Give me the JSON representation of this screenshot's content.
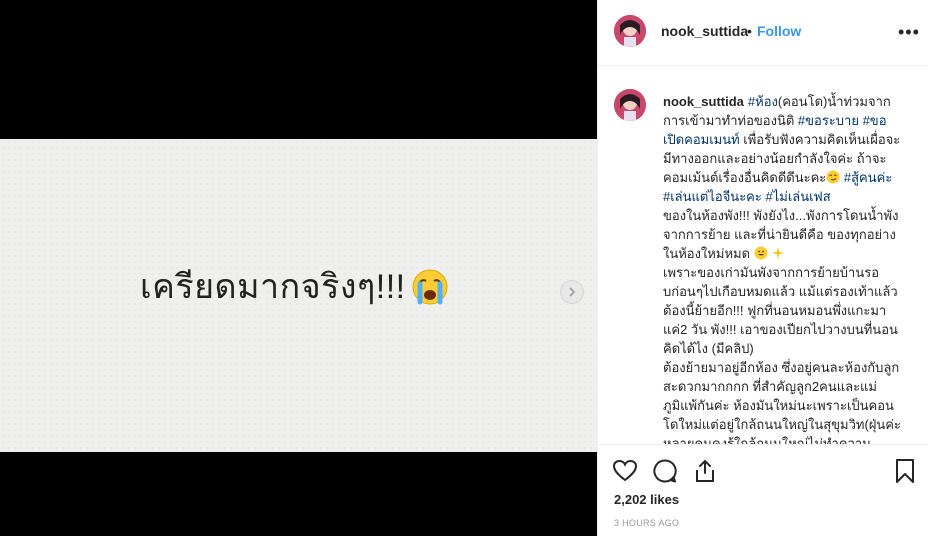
{
  "post": {
    "image_text": "เครียดมากจริงๆ!!!",
    "image_emoji": "crying-face-emoji"
  },
  "header": {
    "username": "nook_suttida",
    "separator": "•",
    "follow_label": "Follow",
    "more_label": "•••"
  },
  "caption": {
    "username": "nook_suttida",
    "segments": [
      {
        "type": "tag",
        "text": "#ห้อง"
      },
      {
        "type": "text",
        "text": "(คอนโด)น้ำท่วมจากการเข้ามาทำท่อของนิติ "
      },
      {
        "type": "tag",
        "text": "#ขอระบาย"
      },
      {
        "type": "text",
        "text": " "
      },
      {
        "type": "tag",
        "text": "#ขอเปิดคอมเมนท์"
      },
      {
        "type": "text",
        "text": " เพื่อรับฟังความคิดเห็นเผื่อจะมีทางออกและอย่างน้อยกำลังใจค่ะ ถ้าจะคอมเม้นต์เรื่องอื่นคิดดีดีนะคะ"
      },
      {
        "type": "emoji",
        "name": "smirk-emoji"
      },
      {
        "type": "text",
        "text": " "
      },
      {
        "type": "tag",
        "text": "#สู้คนค่ะ"
      },
      {
        "type": "text",
        "text": " "
      },
      {
        "type": "tag",
        "text": "#เล่นแต่ไอจีนะคะ"
      },
      {
        "type": "text",
        "text": " "
      },
      {
        "type": "tag",
        "text": "#ไม่เล่นเฟส"
      }
    ],
    "paragraphs": [
      "ของในห้องพัง!!! พังยังไง...พังการโดนน้ำพังจากการย้าย และที่น่ายินดีคือ ของทุกอย่างในห้องใหม่หมด",
      "เพราะของเก่ามันพังจากการย้ายบ้านรอบก่อนๆไปเกือบหมดแล้ว แม้แต่รองเท้าแล้วต้องนี้ย้ายอีก!!! ฟูกที่นอนหมอนพึ่งแกะมาแค่2 วัน พัง!!! เอาของเปียกไปวางบนที่นอนคิดได้ไง (มีคลิป)",
      "ต้องย้ายมาอยู่อีกห้อง ซึ่งอยู่คนละห้องกับลูกสะดวกมากกกก ที่สำคัญลูก2คนและแม่ภูมิแพ้กันค่ะ ห้องมันใหม่นะเพราะเป็นคอนโดใหม่แต่อยู่ใกล้ถนนใหญ่ในสุขุมวิท(ฝุ่นค่ะ หลายคนคงรู้ใกล้ถนนใหญ่ไม่ทำความสะอาดแค่วันเดียวฝุ่นก็ไม่น้อยแล้วค่ะ) นี่"
    ]
  },
  "actions": {
    "like_icon": "heart-icon",
    "comment_icon": "comment-icon",
    "share_icon": "share-icon",
    "save_icon": "bookmark-icon",
    "likes": "2,202 likes",
    "time": "3 HOURS AGO"
  }
}
